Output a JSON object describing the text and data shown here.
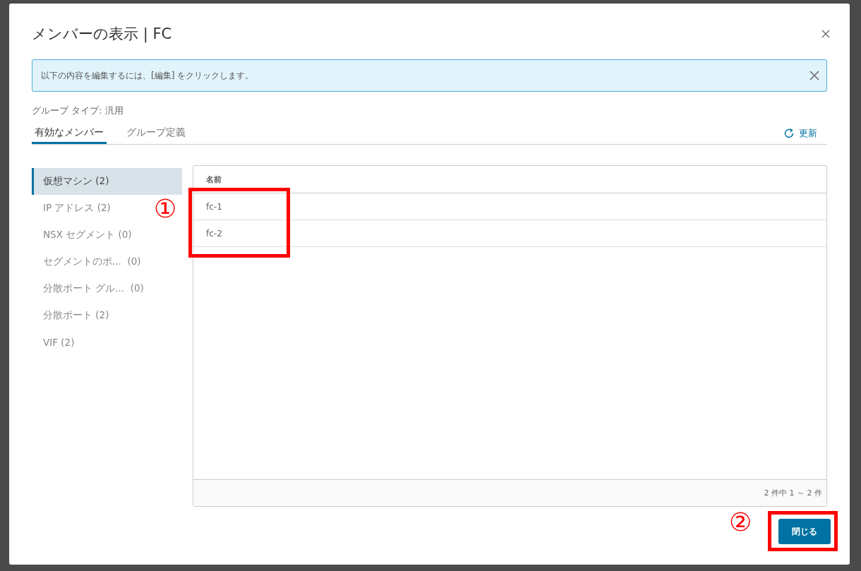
{
  "dialog": {
    "title": "メンバーの表示 | FC"
  },
  "alert": {
    "text": "以下の内容を編集するには、[編集] をクリックします。"
  },
  "group_type": "グループ タイプ: 汎用",
  "tabs": [
    {
      "label": "有効なメンバー",
      "selected": true
    },
    {
      "label": "グループ定義",
      "selected": false
    }
  ],
  "refresh_label": "更新",
  "sidebar": {
    "items": [
      {
        "label": "仮想マシン (2)",
        "selected": true
      },
      {
        "label": "IP アドレス (2)",
        "selected": false
      },
      {
        "label": "NSX セグメント (0)",
        "selected": false
      },
      {
        "label": "セグメントのポ...  (0)",
        "selected": false
      },
      {
        "label": "分散ポート グル...  (0)",
        "selected": false
      },
      {
        "label": "分散ポート (2)",
        "selected": false
      },
      {
        "label": "VIF (2)",
        "selected": false
      }
    ]
  },
  "table": {
    "columns": [
      "名前"
    ],
    "rows": [
      [
        "fc-1"
      ],
      [
        "fc-2"
      ]
    ],
    "footer": "2 件中 1 ～ 2 件"
  },
  "buttons": [
    {
      "label": "閉じる"
    }
  ],
  "annotations": [
    {
      "label": "①"
    },
    {
      "label": "②"
    }
  ]
}
